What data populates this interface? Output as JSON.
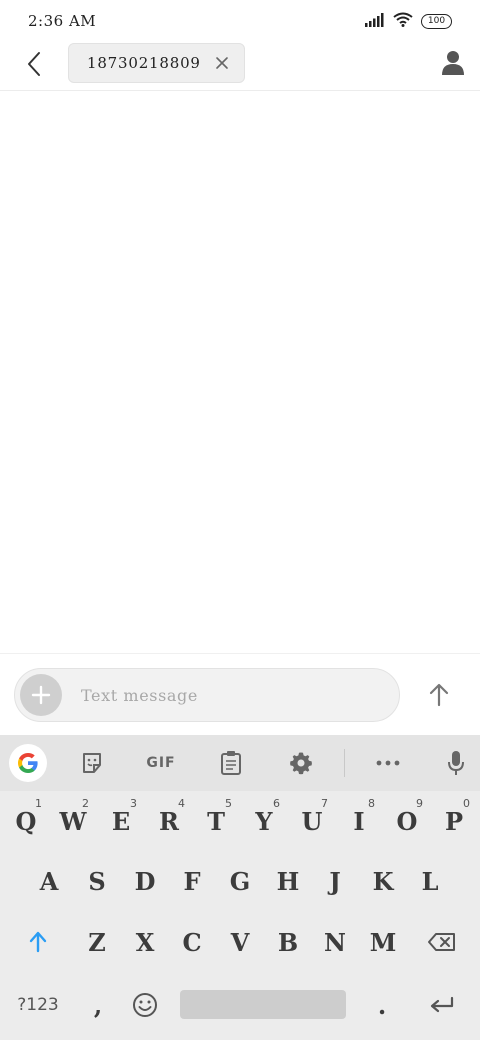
{
  "status_bar": {
    "time": "2:36 AM",
    "battery": "100",
    "icons": [
      "signal-icon",
      "wifi-icon",
      "battery-icon"
    ]
  },
  "header": {
    "back_icon": "back-arrow-icon",
    "recipient": "18730218809",
    "chip_close_icon": "close-icon",
    "contact_icon": "person-icon"
  },
  "compose": {
    "placeholder": "Text message",
    "value": "",
    "add_icon": "plus-icon",
    "send_icon": "arrow-up-icon"
  },
  "keyboard": {
    "toolbar": {
      "google_icon": "google-g-icon",
      "sticker_icon": "sticker-icon",
      "gif_label": "GIF",
      "clipboard_icon": "clipboard-icon",
      "settings_icon": "gear-icon",
      "more_icon": "more-dots-icon",
      "mic_icon": "mic-icon"
    },
    "row1": [
      {
        "label": "Q",
        "hint": "1"
      },
      {
        "label": "W",
        "hint": "2"
      },
      {
        "label": "E",
        "hint": "3"
      },
      {
        "label": "R",
        "hint": "4"
      },
      {
        "label": "T",
        "hint": "5"
      },
      {
        "label": "Y",
        "hint": "6"
      },
      {
        "label": "U",
        "hint": "7"
      },
      {
        "label": "I",
        "hint": "8"
      },
      {
        "label": "O",
        "hint": "9"
      },
      {
        "label": "P",
        "hint": "0"
      }
    ],
    "row2": [
      "A",
      "S",
      "D",
      "F",
      "G",
      "H",
      "J",
      "K",
      "L"
    ],
    "row3": [
      "Z",
      "X",
      "C",
      "V",
      "B",
      "N",
      "M"
    ],
    "row4": {
      "symbols_label": "?123",
      "comma_label": ",",
      "period_label": ".",
      "emoji_icon": "emoji-icon",
      "enter_icon": "enter-icon",
      "shift_icon": "shift-arrow-icon",
      "backspace_icon": "backspace-icon"
    },
    "colors": {
      "accent": "#2a9df4",
      "key_text": "#3c3c3c",
      "background": "#ececec"
    }
  }
}
